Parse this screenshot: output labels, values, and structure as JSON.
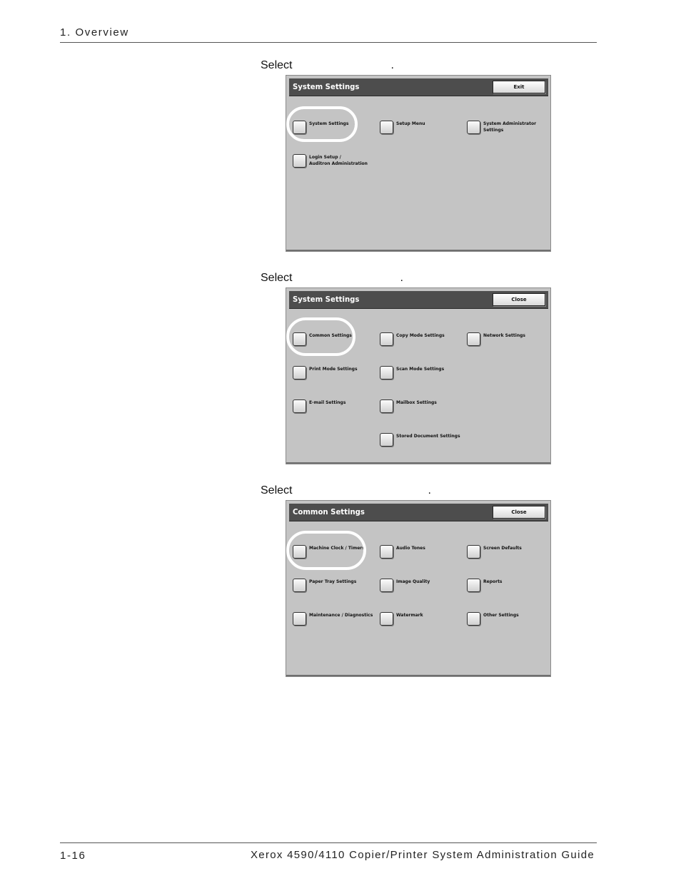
{
  "header": {
    "section": "1. Overview"
  },
  "footer": {
    "page_number": "1-16",
    "guide_title": "Xerox 4590/4110 Copier/Printer System Administration Guide"
  },
  "steps": [
    {
      "label_prefix": "Select",
      "label_suffix": ".",
      "screen": {
        "title": "System Settings",
        "button": "Exit",
        "options": [
          [
            "System Settings"
          ],
          [
            "Setup Menu"
          ],
          [
            "System Administrator",
            "Settings"
          ],
          [
            "Login Setup /",
            "Auditron Administration"
          ]
        ]
      }
    },
    {
      "label_prefix": "Select",
      "label_suffix": ".",
      "screen": {
        "title": "System Settings",
        "button": "Close",
        "options": [
          [
            "Common Settings"
          ],
          [
            "Copy Mode Settings"
          ],
          [
            "Network Settings"
          ],
          [
            "Print Mode Settings"
          ],
          [
            "Scan Mode Settings"
          ],
          [
            "E-mail Settings"
          ],
          [
            "Mailbox Settings"
          ],
          [
            "Stored Document Settings"
          ]
        ]
      }
    },
    {
      "label_prefix": "Select",
      "label_suffix": ".",
      "screen": {
        "title": "Common Settings",
        "button": "Close",
        "options": [
          [
            "Machine Clock / Timers"
          ],
          [
            "Audio Tones"
          ],
          [
            "Screen Defaults"
          ],
          [
            "Paper Tray Settings"
          ],
          [
            "Image Quality"
          ],
          [
            "Reports"
          ],
          [
            "Maintenance / Diagnostics"
          ],
          [
            "Watermark"
          ],
          [
            "Other Settings"
          ]
        ]
      }
    }
  ]
}
